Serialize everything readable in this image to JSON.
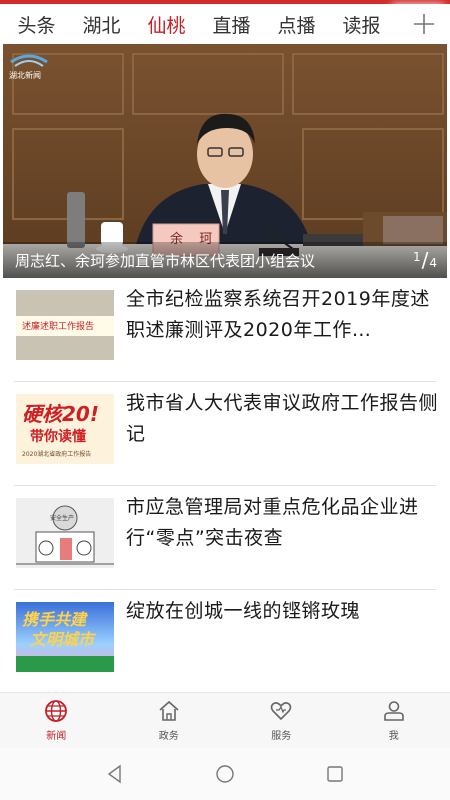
{
  "tabs": [
    {
      "label": "头条",
      "active": false
    },
    {
      "label": "湖北",
      "active": false
    },
    {
      "label": "仙桃",
      "active": true
    },
    {
      "label": "直播",
      "active": false
    },
    {
      "label": "点播",
      "active": false
    },
    {
      "label": "读报",
      "active": false
    }
  ],
  "hero": {
    "logo_text": "湖北新闻",
    "nameplate": "余 珂",
    "caption": "周志红、余珂参加直管市林区代表团小组会议",
    "page_current": "1",
    "page_total": "4"
  },
  "news": [
    {
      "headline": "全市纪检监察系统召开2019年度述职述廉测评及2020年工作…",
      "thumb_text": "述廉述职工作报告"
    },
    {
      "headline": "我市省人大代表审议政府工作报告侧记",
      "thumb_text_main": "硬核20!",
      "thumb_text_sub": "带你读懂",
      "thumb_text_small": "2020湖北省政府工作报告"
    },
    {
      "headline": "市应急管理局对重点危化品企业进行“零点”突击夜查",
      "thumb_text": "安全生产"
    },
    {
      "headline": "绽放在创城一线的铿锵玫瑰",
      "thumb_text_main": "携手共建",
      "thumb_text_sub": "文明城市"
    }
  ],
  "bottom_nav": [
    {
      "label": "新闻",
      "icon": "globe-icon",
      "active": true
    },
    {
      "label": "政务",
      "icon": "home-icon",
      "active": false
    },
    {
      "label": "服务",
      "icon": "heart-icon",
      "active": false
    },
    {
      "label": "我",
      "icon": "user-icon",
      "active": false
    }
  ],
  "colors": {
    "accent": "#c71f24",
    "topbar_line": "#d42a2a"
  }
}
